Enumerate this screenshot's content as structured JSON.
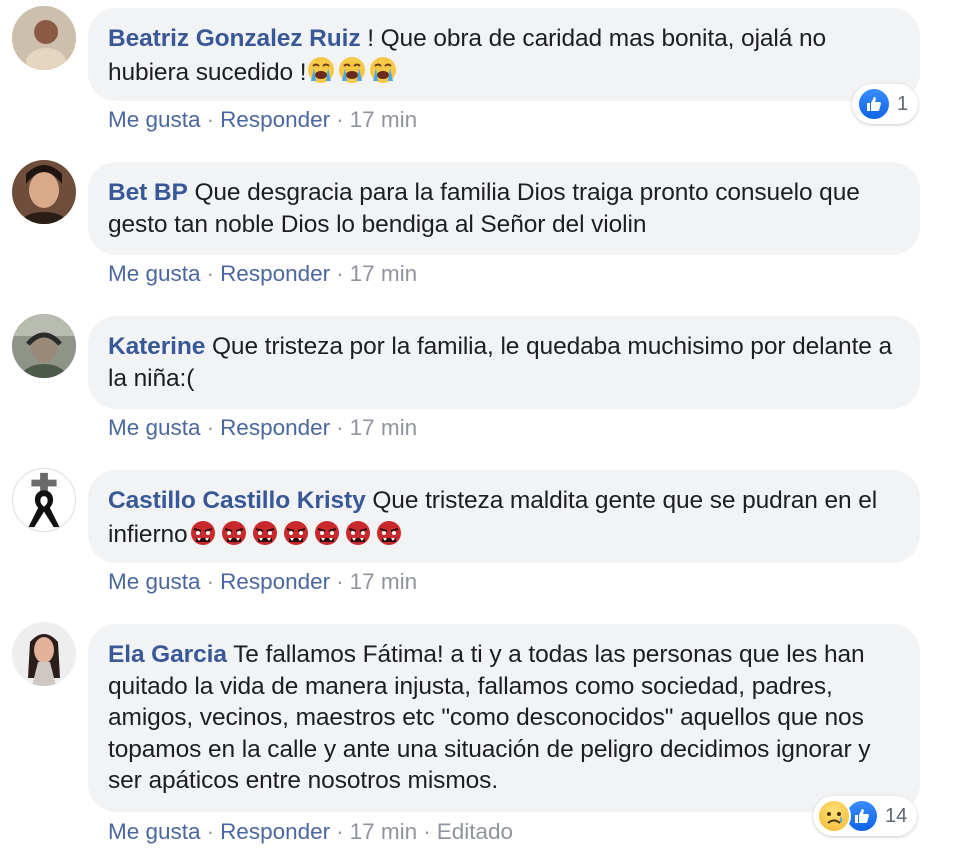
{
  "comments": [
    {
      "author": "Beatriz Gonzalez Ruiz",
      "text": " ! Que obra de caridad mas bonita, ojalá no hubiera sucedido !",
      "emoji": [
        "crying-face",
        "crying-face",
        "crying-face"
      ],
      "like_label": "Me gusta",
      "reply_label": "Responder",
      "time": "17 min",
      "reaction_count": "1"
    },
    {
      "author": "Bet BP",
      "text": " Que desgracia para la familia Dios traiga pronto consuelo que gesto tan noble Dios lo bendiga al Señor del violin",
      "like_label": "Me gusta",
      "reply_label": "Responder",
      "time": "17 min"
    },
    {
      "author": "Katerine",
      "text": " Que tristeza por la familia, le quedaba muchisimo por delante a la niña:(",
      "like_label": "Me gusta",
      "reply_label": "Responder",
      "time": "17 min"
    },
    {
      "author": "Castillo Castillo Kristy",
      "text": " Que tristeza maldita gente que se pudran en el infierno",
      "emoji": [
        "ogre-face",
        "ogre-face",
        "ogre-face",
        "ogre-face",
        "ogre-face",
        "ogre-face",
        "ogre-face"
      ],
      "like_label": "Me gusta",
      "reply_label": "Responder",
      "time": "17 min"
    },
    {
      "author": "Ela Garcia",
      "text": " Te fallamos Fátima! a ti y a todas las personas que les han quitado la vida de manera injusta, fallamos como sociedad, padres, amigos, vecinos, maestros etc \"como desconocidos\" aquellos que nos topamos en la calle y ante una situación de peligro decidimos ignorar y ser apáticos entre nosotros mismos.",
      "like_label": "Me gusta",
      "reply_label": "Responder",
      "time": "17 min",
      "edited_label": "Editado",
      "reaction_count": "14"
    }
  ],
  "colors": {
    "author": "#385898",
    "bubble": "#f2f3f5",
    "action_link": "#4b67a1",
    "meta": "#90949c",
    "like_blue": "#1877f2"
  }
}
